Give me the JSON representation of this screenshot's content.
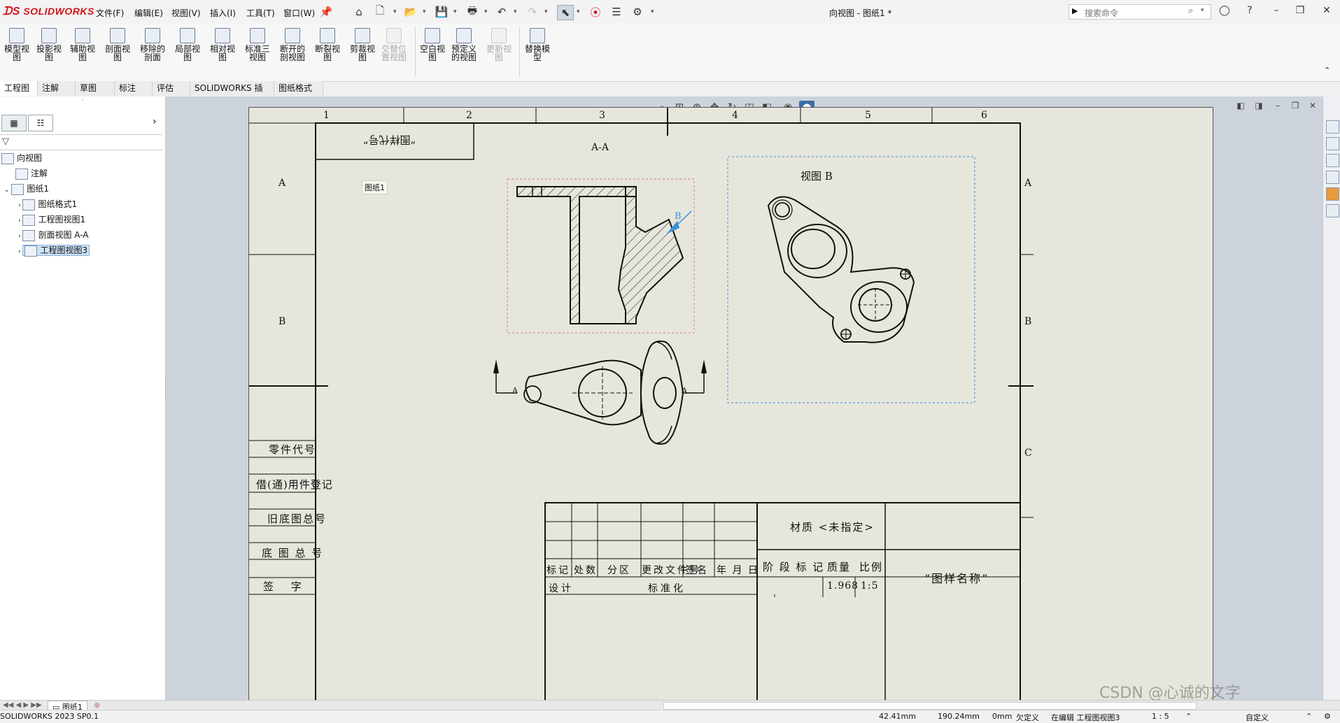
{
  "app": {
    "brand": "SOLIDWORKS",
    "window_title": "向视图 - 图纸1 *",
    "search_placeholder": "搜索命令"
  },
  "menu": [
    "文件(F)",
    "编辑(E)",
    "视图(V)",
    "插入(I)",
    "工具(T)",
    "窗口(W)"
  ],
  "ribbon": [
    {
      "label": "模型视图",
      "disabled": false
    },
    {
      "label": "投影视图",
      "disabled": false
    },
    {
      "label": "辅助视图",
      "disabled": false
    },
    {
      "label": "剖面视图",
      "disabled": false
    },
    {
      "label": "移除的剖面",
      "disabled": false
    },
    {
      "label": "局部视图",
      "disabled": false
    },
    {
      "label": "相对视图",
      "disabled": false
    },
    {
      "label": "标准三视图",
      "disabled": false
    },
    {
      "label": "断开的剖视图",
      "disabled": false
    },
    {
      "label": "断裂视图",
      "disabled": false
    },
    {
      "label": "剪裁视图",
      "disabled": false
    },
    {
      "label": "交替位置视图",
      "disabled": true
    },
    {
      "label": "空白视图",
      "disabled": false
    },
    {
      "label": "预定义的视图",
      "disabled": false
    },
    {
      "label": "更新视图",
      "disabled": true
    },
    {
      "label": "替换模型",
      "disabled": false
    }
  ],
  "tabs": [
    "工程图",
    "注解",
    "草图",
    "标注",
    "评估",
    "SOLIDWORKS 插件",
    "图纸格式"
  ],
  "tree": {
    "root": "向视图",
    "annotation": "注解",
    "sheet": "图纸1",
    "children": [
      "图纸格式1",
      "工程图视图1",
      "剖面视图 A-A",
      "工程图视图3"
    ]
  },
  "drawing": {
    "col_labels": [
      "1",
      "2",
      "3",
      "4",
      "5",
      "6"
    ],
    "row_labels": [
      "A",
      "B",
      "C"
    ],
    "code_box": "“图样代号”",
    "sheet_tag": "图纸1",
    "section_title": "A-A",
    "view_b_title": "视图 B",
    "arrow_b": "B",
    "section_marks": [
      "A",
      "A"
    ],
    "left_table": [
      "零件代号",
      "借(通)用件登记",
      "旧底图总号",
      "底 图 总 号",
      "签 字"
    ],
    "title_block": {
      "headers": [
        "标记",
        "处数",
        "分区",
        "更改文件号",
        "签名",
        "年 月 日"
      ],
      "design": "设计",
      "standard": "标准化",
      "material": "材质 <未指定>",
      "stage": "阶 段 标 记",
      "mass_label": "质量",
      "scale_label": "比例",
      "mass": "1.968",
      "scale": "1:5",
      "drawing_name": "“图样名称”"
    }
  },
  "bottom_tab": "图纸1",
  "status": {
    "version": "SOLIDWORKS 2023 SP0.1",
    "x": "42.41mm",
    "y": "190.24mm",
    "z": "0mm",
    "state": "欠定义",
    "editing": "在编辑 工程图视图3",
    "scale": "1 : 5",
    "custom": "自定义",
    "watermark": "CSDN @心诚的文字"
  }
}
